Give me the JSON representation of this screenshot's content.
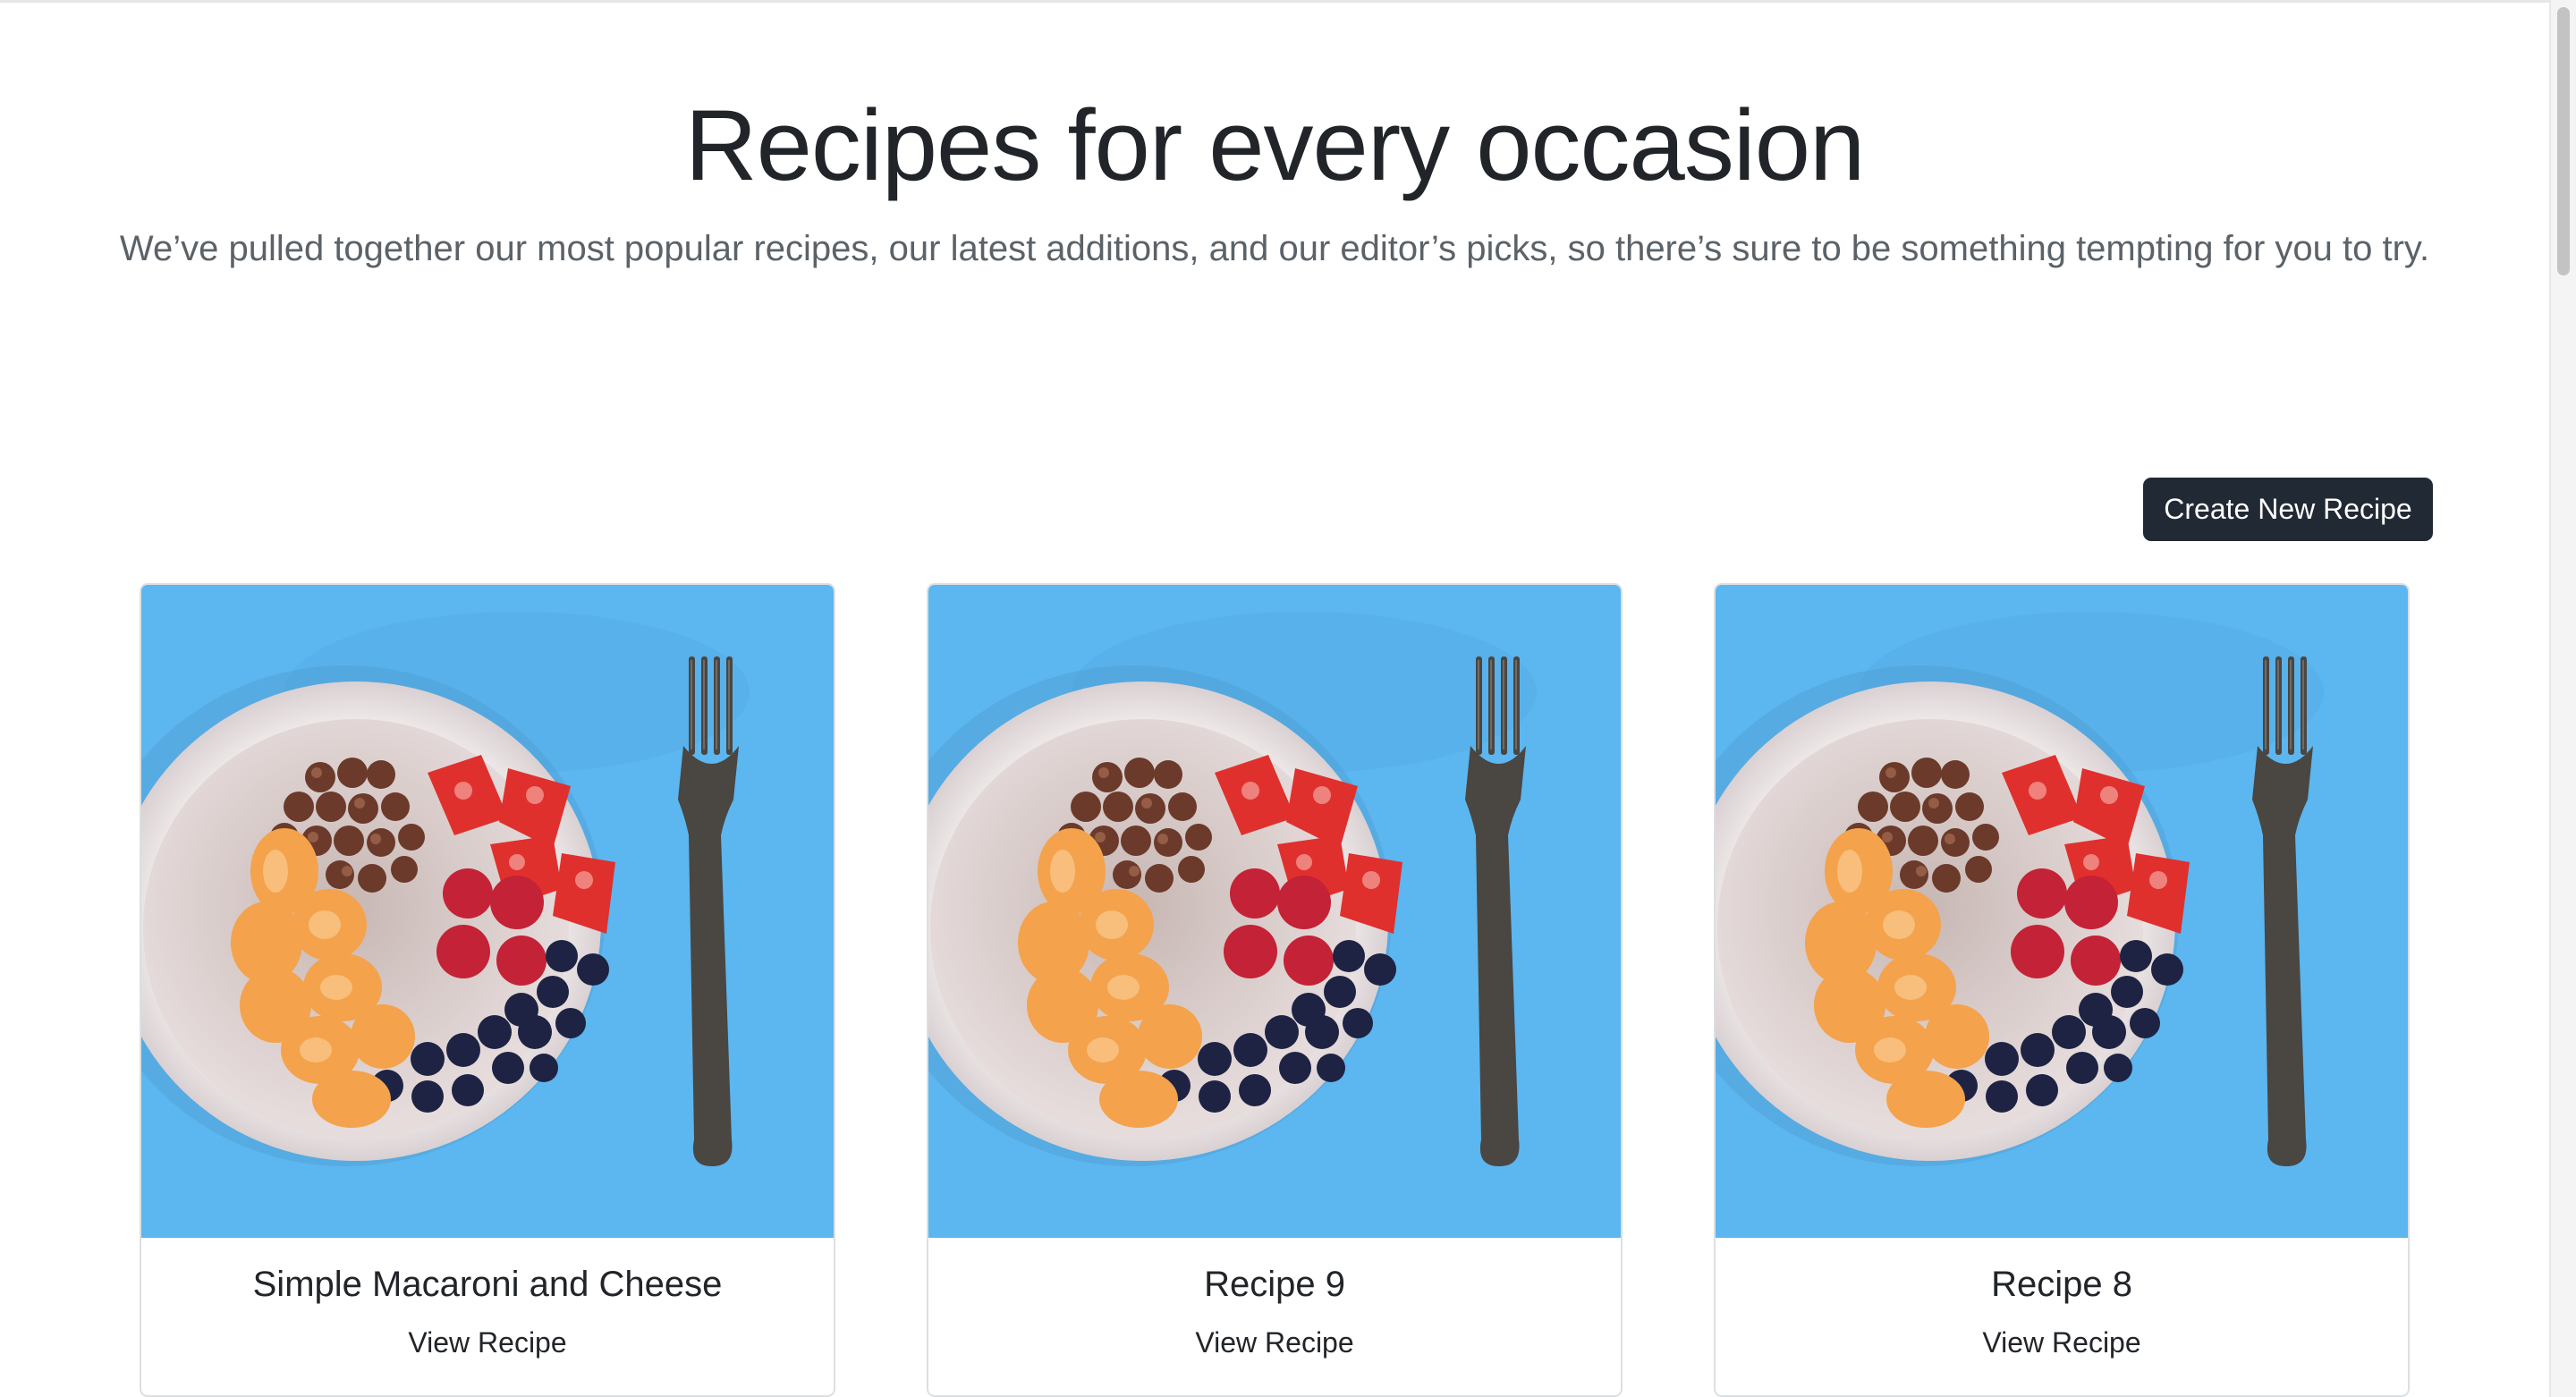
{
  "hero": {
    "title": "Recipes for every occasion",
    "subtitle": "We’ve pulled together our most popular recipes, our latest additions, and our editor’s picks, so there’s sure to be something tempting for you to try."
  },
  "actions": {
    "create_label": "Create New Recipe"
  },
  "recipes": [
    {
      "title": "Simple Macaroni and Cheese",
      "link_label": "View Recipe"
    },
    {
      "title": "Recipe 9",
      "link_label": "View Recipe"
    },
    {
      "title": "Recipe 8",
      "link_label": "View Recipe"
    }
  ],
  "colors": {
    "button_bg": "#212934",
    "image_bg": "#5cb6ef",
    "text": "#212529",
    "muted_text": "#5b6268"
  },
  "icons": {
    "card_image": "fruit-bowl-photo"
  }
}
